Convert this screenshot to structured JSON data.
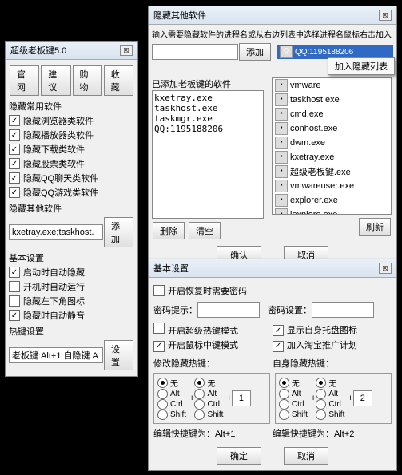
{
  "win1": {
    "title": "超级老板键5.0",
    "tabs": [
      "官网",
      "建议",
      "购物",
      "收藏"
    ],
    "sec1": "隐藏常用软件",
    "c": [
      {
        "lb": "隐藏浏览器类软件",
        "on": true
      },
      {
        "lb": "隐藏播放器类软件",
        "on": true
      },
      {
        "lb": "隐藏下载类软件",
        "on": true
      },
      {
        "lb": "隐藏股票类软件",
        "on": true
      },
      {
        "lb": "隐藏QQ聊天类软件",
        "on": true
      },
      {
        "lb": "隐藏QQ游戏类软件",
        "on": true
      }
    ],
    "sec2": "隐藏其他软件",
    "other_val": "kxetray.exe;taskhost.",
    "add_btn": "添加",
    "sec3": "基本设置",
    "b": [
      {
        "lb": "启动时自动隐藏",
        "on": true
      },
      {
        "lb": "开机时自动运行",
        "on": false
      },
      {
        "lb": "隐藏左下角图标",
        "on": false
      },
      {
        "lb": "隐藏时自动静音",
        "on": true
      }
    ],
    "sec4": "热键设置",
    "hk_val": "老板键:Alt+1 自隐键:A",
    "set_btn": "设置"
  },
  "win2": {
    "title": "隐藏其他软件",
    "instr": "输入需要隐藏软件的进程名或从右边列表中选择进程名鼠标右击加入",
    "add_btn": "添加",
    "sel_lbl": "QQ:1195188206",
    "ctx_menu": "加入隐藏列表",
    "left_lbl": "已添加老板键的软件",
    "added": [
      "kxetray.exe",
      "taskhost.exe",
      "taskmgr.exe",
      "QQ:1195188206"
    ],
    "proc": [
      {
        "n": "vmware"
      },
      {
        "n": "taskhost.exe"
      },
      {
        "n": "cmd.exe"
      },
      {
        "n": "conhost.exe"
      },
      {
        "n": "dwm.exe"
      },
      {
        "n": "kxetray.exe"
      },
      {
        "n": "超级老板键.exe"
      },
      {
        "n": "vmwareuser.exe"
      },
      {
        "n": "explorer.exe"
      },
      {
        "n": "iexplore.exe"
      }
    ],
    "del": "删除",
    "clr": "清空",
    "ref": "刷新",
    "ok": "确认",
    "cancel": "取消"
  },
  "win3": {
    "title": "基本设置",
    "r1": {
      "lb": "开启恢复时需要密码",
      "on": false
    },
    "pw_hint": "密码提示：",
    "pw_set": "密码设置：",
    "r2a": {
      "lb": "开启超级热键模式",
      "on": false
    },
    "r2b": {
      "lb": "显示自身托盘图标",
      "on": true
    },
    "r3a": {
      "lb": "开启鼠标中键模式",
      "on": true
    },
    "r3b": {
      "lb": "加入淘宝推广计划",
      "on": true
    },
    "mod_lbl": "修改隐藏热键：",
    "self_lbl": "自身隐藏热键：",
    "keys": [
      "无",
      "Alt",
      "Ctrl",
      "Shift"
    ],
    "k1": "1",
    "k2": "2",
    "edit1": "编辑快捷键为：Alt+1",
    "edit2": "编辑快捷键为：Alt+2",
    "ok": "确定",
    "cancel": "取消"
  }
}
